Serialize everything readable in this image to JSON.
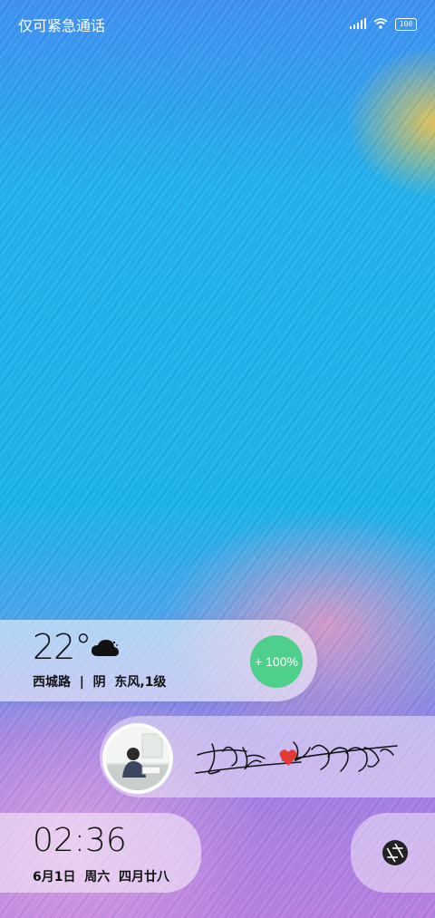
{
  "status_bar": {
    "carrier_text": "仅可紧急通话",
    "battery_level": "100",
    "icons": [
      "signal-icon",
      "wifi-icon",
      "battery-icon"
    ]
  },
  "weather": {
    "temperature": "22°",
    "location": "西城路",
    "separator": "|",
    "condition_wind": "阴  东风,1级",
    "icon": "cloudy-night-icon"
  },
  "charging": {
    "label": "+ 100%",
    "color": "#4fcf8c"
  },
  "signature": {
    "icon": "heart-icon",
    "heart_color": "#e53935"
  },
  "clock": {
    "time": "02:36",
    "date": "6月1日  周六  四月廿八"
  },
  "camera": {
    "icon": "camera-shutter-icon"
  }
}
